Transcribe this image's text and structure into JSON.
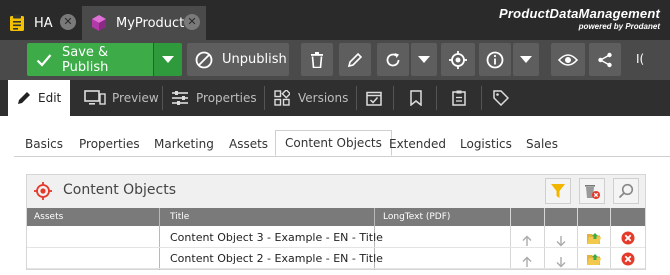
{
  "doc_tabs": [
    {
      "label": "HA",
      "active": false
    },
    {
      "label": "MyProduct",
      "active": true
    }
  ],
  "brand": {
    "name": "ProductDataManagement",
    "tagline": "powered by Prodanet"
  },
  "toolbar": {
    "save_publish_label": "Save & Publish",
    "unpublish_label": "Unpublish",
    "overflow_label": "I(",
    "colors": {
      "publish": "#3cab48",
      "toolbar_bg": "#4a4a4a",
      "button_bg": "#5e5e5e"
    }
  },
  "edit_tabs": [
    {
      "label": "Edit",
      "active": true
    },
    {
      "label": "Preview",
      "active": false
    },
    {
      "label": "Properties",
      "active": false
    },
    {
      "label": "Versions",
      "active": false
    }
  ],
  "sub_tabs": [
    "Basics",
    "Properties",
    "Marketing",
    "Assets",
    "Content Objects",
    "Extended",
    "Logistics",
    "Sales"
  ],
  "sub_tabs_active": "Content Objects",
  "panel": {
    "title": "Content Objects",
    "columns": [
      "Assets",
      "Title",
      "LongText (PDF)"
    ],
    "rows": [
      {
        "assets": "",
        "title": "Content Object 3 - Example - EN - Title",
        "longtext": ""
      },
      {
        "assets": "",
        "title": "Content Object 2 - Example - EN - Title",
        "longtext": ""
      }
    ]
  }
}
